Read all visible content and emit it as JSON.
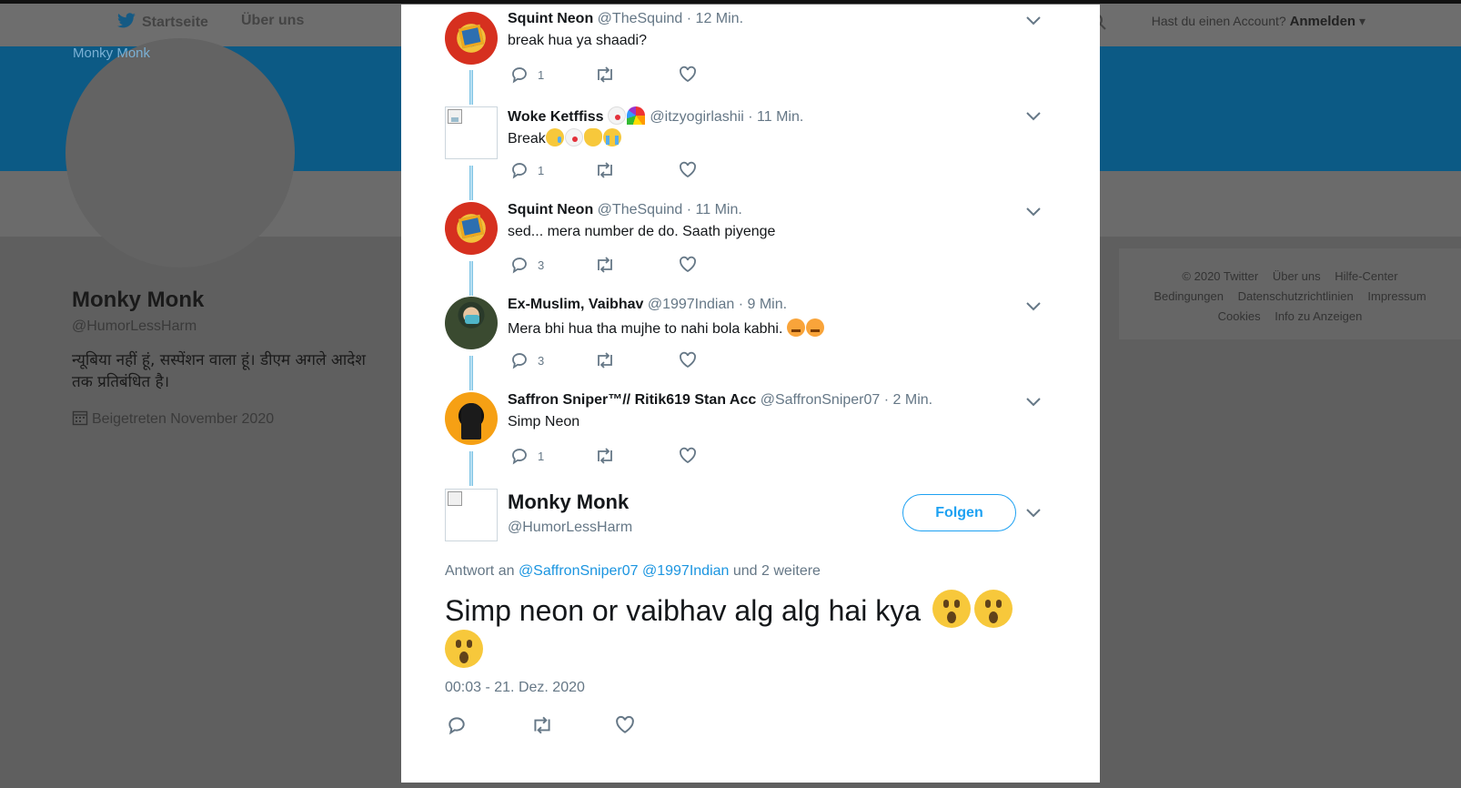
{
  "topnav": {
    "home": "Startseite",
    "about": "Über uns",
    "account_prompt": "Hast du einen Account?",
    "login": "Anmelden"
  },
  "profile": {
    "avatar_alt": "Monky Monk",
    "name": "Monky Monk",
    "handle": "@HumorLessHarm",
    "bio": "न्यूबिया नहीं हूं, सस्पेंशन वाला हूं। डीएम अगले आदेश तक प्रतिबंधित है।",
    "joined": "Beigetreten November 2020"
  },
  "footer": {
    "links": [
      "© 2020 Twitter",
      "Über uns",
      "Hilfe-Center",
      "Bedingungen",
      "Datenschutzrichtlinien",
      "Impressum",
      "Cookies",
      "Info zu Anzeigen"
    ]
  },
  "tweets": [
    {
      "name": "Squint Neon",
      "handle": "@TheSquind",
      "time": "· 12 Min.",
      "text": "break hua ya shaadi?",
      "reply_count": "1"
    },
    {
      "name": "Woke Ketffiss",
      "handle": "@itzyogirlashii",
      "time": "· 11 Min.",
      "text": "Break",
      "reply_count": "1"
    },
    {
      "name": "Squint Neon",
      "handle": "@TheSquind",
      "time": "· 11 Min.",
      "text": "sed... mera number de do. Saath piyenge",
      "reply_count": "3"
    },
    {
      "name": "Ex-Muslim, Vaibhav",
      "handle": "@1997Indian",
      "time": "· 9 Min.",
      "text": "Mera bhi hua tha mujhe to nahi bola kabhi.",
      "reply_count": "3"
    },
    {
      "name": "Saffron Sniper™// Ritik619 Stan Acc",
      "handle": "@SaffronSniper07",
      "time": "· 2 Min.",
      "text": "Simp Neon",
      "reply_count": "1"
    }
  ],
  "main_tweet": {
    "name": "Monky Monk",
    "handle": "@HumorLessHarm",
    "follow_label": "Folgen",
    "reply_prefix": "Antwort an",
    "mention1": "@SaffronSniper07",
    "mention2": "@1997Indian",
    "reply_suffix": "und 2 weitere",
    "text": "Simp neon or vaibhav alg alg hai kya",
    "timestamp": "00:03 - 21. Dez. 2020"
  },
  "colors": {
    "accent": "#1da1f2",
    "mention": "#1b95e0",
    "muted": "#657786",
    "overlay_bg": "#5f5f5f"
  }
}
